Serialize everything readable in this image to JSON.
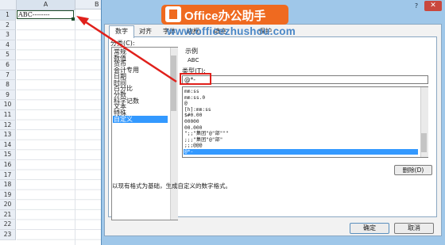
{
  "spreadsheet": {
    "columns": [
      "A",
      "B"
    ],
    "rows": [
      "1",
      "2",
      "3",
      "4",
      "5",
      "6",
      "7",
      "8",
      "9",
      "10",
      "11",
      "12",
      "13",
      "14",
      "15",
      "16",
      "17",
      "18",
      "19",
      "20",
      "21",
      "22",
      "23"
    ],
    "cell_a1": "ABC--------"
  },
  "banner": {
    "text": "Office办公助手",
    "website": "www.officezhushou.com"
  },
  "dialog": {
    "title_fragment": "格式",
    "help_label": "?",
    "close_label": "✕",
    "tabs": [
      "数字",
      "对齐",
      "字体",
      "边框",
      "填充",
      "保护"
    ],
    "category_label": "分类(C):",
    "categories": [
      "常规",
      "数值",
      "货币",
      "会计专用",
      "日期",
      "时间",
      "百分比",
      "分数",
      "科学记数",
      "文本",
      "特殊",
      "自定义"
    ],
    "selected_category": "自定义",
    "sample_label": "示例",
    "sample_value": "ABC",
    "type_label": "类型(T):",
    "type_value": "@*-",
    "formats": [
      "mm:ss",
      "mm:ss.0",
      "@",
      "[h]:mm:ss",
      "$#0.00",
      "00000",
      "00.000",
      "\";;\"集团\"@\"部\"\"\"",
      ";;;\"集团\"@\"部\"",
      ";;;@@@",
      "@*-"
    ],
    "selected_format": "@*-",
    "delete_label": "删除(D)",
    "description": "以现有格式为基础，生成自定义的数字格式。",
    "ok_label": "确定",
    "cancel_label": "取消"
  },
  "colors": {
    "accent_orange": "#ef6a20",
    "highlight_red": "#e0201b",
    "selection_blue": "#3399ff",
    "dialog_frame": "#9fc7e9"
  }
}
